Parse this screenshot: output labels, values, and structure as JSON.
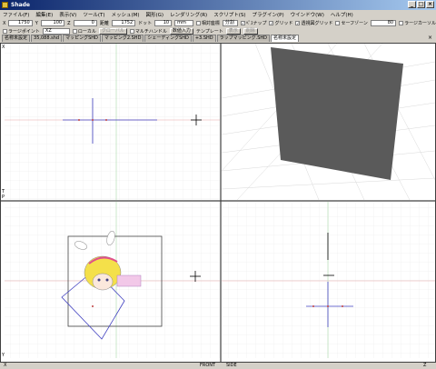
{
  "window": {
    "title": "Shade"
  },
  "menu": [
    "ファイル(F)",
    "編集(E)",
    "表示(V)",
    "ツール(T)",
    "メッシュ(M)",
    "図形(G)",
    "レンダリング(R)",
    "スクリプト(S)",
    "プラグイン(P)",
    "ウインドウ(W)",
    "ヘルプ(H)"
  ],
  "coordbar": {
    "x_label": "X",
    "x_value": "1750",
    "y_label": "Y",
    "y_value": "100",
    "z_label": "Z",
    "z_value": "0",
    "dist_label": "距離",
    "dist_value": "1752",
    "dot_label": "ドット",
    "dot_value": "10",
    "unit": "mm",
    "relative_label": "相対座標",
    "split_value": "分割",
    "snap_label": "ﾍﾟｽナップ",
    "grid_label": "グリッド",
    "pspgrid_label": "透視図グリッド",
    "safezone_label": "セーフゾーン",
    "safezone_value": "80",
    "largecursor_label": "ラージカーソル"
  },
  "optionbar": {
    "largepoint_label": "ラージポイント",
    "plane_value": "XZ",
    "local_label": "ローカル",
    "global_label": "グローバル",
    "multihandle_label": "マルチハンドル",
    "numeric_input": "数値入力",
    "template_label": "テンプレート",
    "show_label": "表示",
    "delete_label": "削除"
  },
  "tabs": [
    "名称未設定",
    "35,088.shd",
    "マッピングSHD",
    "マッピング2.SHD",
    "シェーディングSHD",
    "+3.SHD",
    "ラップマッピング.SHD",
    "名称未設定"
  ],
  "active_tab": 7,
  "status": {
    "front": "FRONT",
    "side": "SIDE",
    "left_axis": "X",
    "right_axis": "Z"
  },
  "viewport_labels": {
    "top_left_axis": "X",
    "top_axis_t": "T",
    "top_axis_p": "P",
    "bottom_y": "Y"
  },
  "colors": {
    "accent": "#0a246a",
    "axis_x": "#c04040",
    "axis_z": "#4040c0",
    "cube": "#5a5a5a"
  }
}
